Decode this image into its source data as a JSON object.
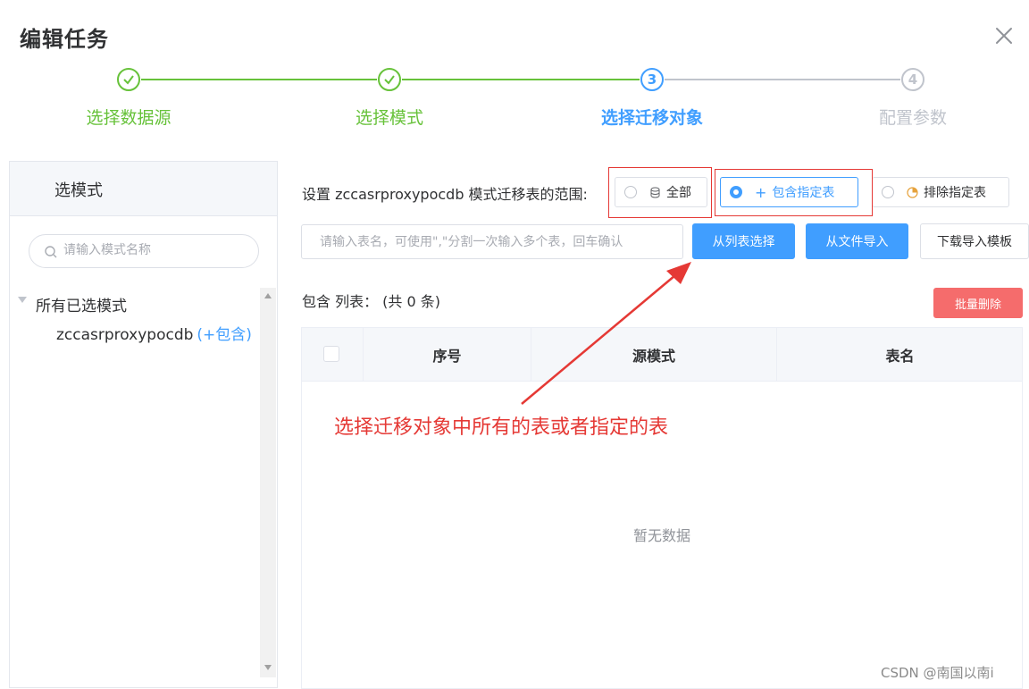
{
  "dialog": {
    "title": "编辑任务"
  },
  "steps": [
    {
      "label": "选择数据源",
      "status": "finish"
    },
    {
      "label": "选择模式",
      "status": "finish"
    },
    {
      "label": "选择迁移对象",
      "number": "3",
      "status": "process"
    },
    {
      "label": "配置参数",
      "number": "4",
      "status": "wait"
    }
  ],
  "left": {
    "header": "选模式",
    "search_placeholder": "请输入模式名称",
    "tree_root": "所有已选模式",
    "tree_child": "zccasrproxypocdb",
    "tree_child_tag": "(+包含)"
  },
  "scope": {
    "label": "设置 zccasrproxypocdb 模式迁移表的范围:",
    "options": [
      {
        "label": "全部",
        "checked": false
      },
      {
        "label": "包含指定表",
        "checked": true
      },
      {
        "label": "排除指定表",
        "checked": false
      }
    ]
  },
  "toolbar": {
    "input_placeholder": "请输入表名，可使用\",\"分割一次输入多个表，回车确认",
    "select_from_list": "从列表选择",
    "import_from_file": "从文件导入",
    "download_template": "下载导入模板"
  },
  "list": {
    "title": "包含 列表：  (共 0 条)",
    "batch_delete": "批量删除",
    "columns": [
      "序号",
      "源模式",
      "表名"
    ],
    "empty_text": "暂无数据"
  },
  "annotation": "选择迁移对象中所有的表或者指定的表",
  "watermark": "CSDN @南国以南i",
  "colors": {
    "success": "#67c23a",
    "primary": "#409eff",
    "wait": "#c0c4cc",
    "danger": "#f56c6c",
    "annotation": "#e53935"
  }
}
